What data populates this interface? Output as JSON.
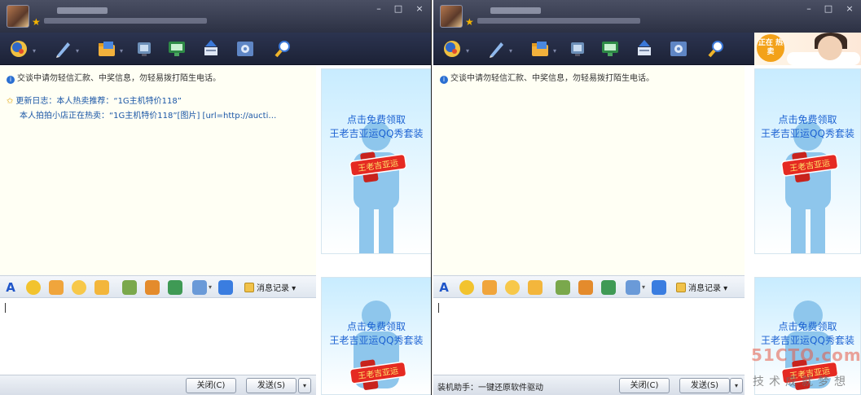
{
  "colors": {
    "title_bar": "#2c3144",
    "toolbar": "#1c2236",
    "chat_bg": "#fffff4",
    "link_blue": "#1a56a6",
    "ad_text": "#1c62d2"
  },
  "window_controls": {
    "minimize": "–",
    "maximize": "□",
    "close": "×"
  },
  "toolbar_icons": [
    "face-icon",
    "pen-icon",
    "folder-icon",
    "video-icon",
    "screen-icon",
    "transfer-icon",
    "settings-icon",
    "search-icon"
  ],
  "chat": {
    "notice": "交谈中请勿轻信汇款、中奖信息，勿轻易拨打陌生电话。",
    "update_line1": "更新日志：本人热卖推荐：“1G主机特价118”",
    "update_line2": "本人拍拍小店正在热卖：“1G主机特价118”[图片]  [url=http://aucti…"
  },
  "input_toolbar": {
    "font_icon_label": "A",
    "icons": [
      "emoji-icon",
      "magic-face-icon",
      "wink-icon",
      "jump-icon",
      "image-icon",
      "gift-icon",
      "music-icon",
      "screenshot-icon",
      "sketch-icon",
      "message-record-icon"
    ],
    "message_record_label": "消息记录"
  },
  "bottom": {
    "close_label": "关闭(C)",
    "send_label": "发送(S)",
    "dropdown_label": "▾",
    "helper_text": "装机助手：一键还原软件驱动"
  },
  "ad": {
    "line1": "点击免费领取",
    "line2": "王老吉亚运QQ秀套装",
    "can_text": "王老吉亚运"
  },
  "promo": {
    "badge": "正在 热卖"
  },
  "watermark": {
    "line1": "51CTO.com",
    "line2": "技术成就梦想"
  }
}
